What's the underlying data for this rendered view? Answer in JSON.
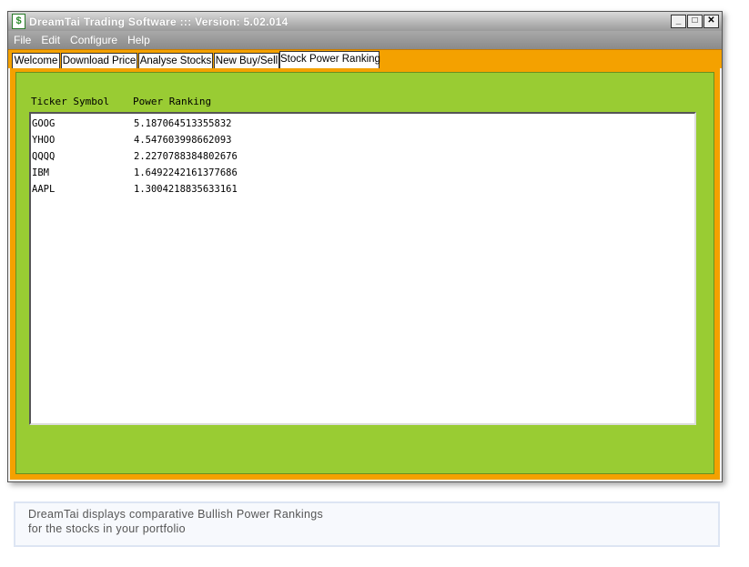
{
  "window": {
    "title": "DreamTai Trading Software   :::  Version: 5.02.014",
    "app_icon_glyph": "$",
    "title_separator": ":::",
    "controls": {
      "minimize": "_",
      "maximize": "□",
      "close": "✕"
    }
  },
  "menubar": {
    "items": [
      "File",
      "Edit",
      "Configure",
      "Help"
    ]
  },
  "tabs": [
    {
      "label": "Welcome",
      "active": false
    },
    {
      "label": "Download Price",
      "active": false
    },
    {
      "label": "Analyse Stocks",
      "active": false
    },
    {
      "label": "New Buy/Sell",
      "active": false
    },
    {
      "label": "Stock Power Ranking",
      "active": true
    }
  ],
  "ranking": {
    "header_ticker": "Ticker Symbol",
    "header_rank": "Power Ranking",
    "rows": [
      {
        "ticker": "GOOG",
        "rank": "5.187064513355832"
      },
      {
        "ticker": "YHOO",
        "rank": "4.547603998662093"
      },
      {
        "ticker": "QQQQ",
        "rank": "2.2270788384802676"
      },
      {
        "ticker": "IBM",
        "rank": "1.6492242161377686"
      },
      {
        "ticker": "AAPL",
        "rank": "1.3004218835633161"
      }
    ]
  },
  "caption": {
    "line1": "DreamTai displays comparative Bullish Power Rankings",
    "line2": "for the stocks in your portfolio"
  },
  "colors": {
    "orange_frame": "#f4a100",
    "green_panel": "#99cc33",
    "menubar_gray": "#9a9a9a"
  }
}
